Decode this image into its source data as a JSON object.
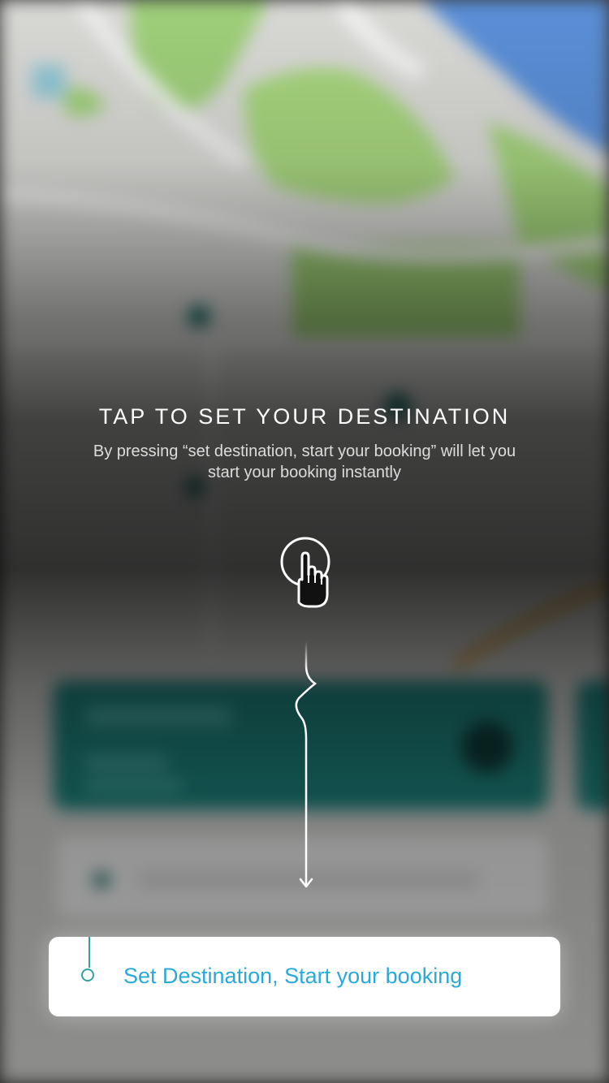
{
  "coach": {
    "title": "TAP TO SET YOUR DESTINATION",
    "description": "By pressing “set destination, start your booking” will let you start your booking instantly",
    "icon": "tap-hand-icon"
  },
  "cta": {
    "label": "Set Destination, Start your booking",
    "icon": "origin-ring-icon"
  },
  "colors": {
    "accent": "#2aa9d9",
    "teal": "#2ea3a0",
    "overlay": "#000000",
    "card": "#ffffff"
  }
}
